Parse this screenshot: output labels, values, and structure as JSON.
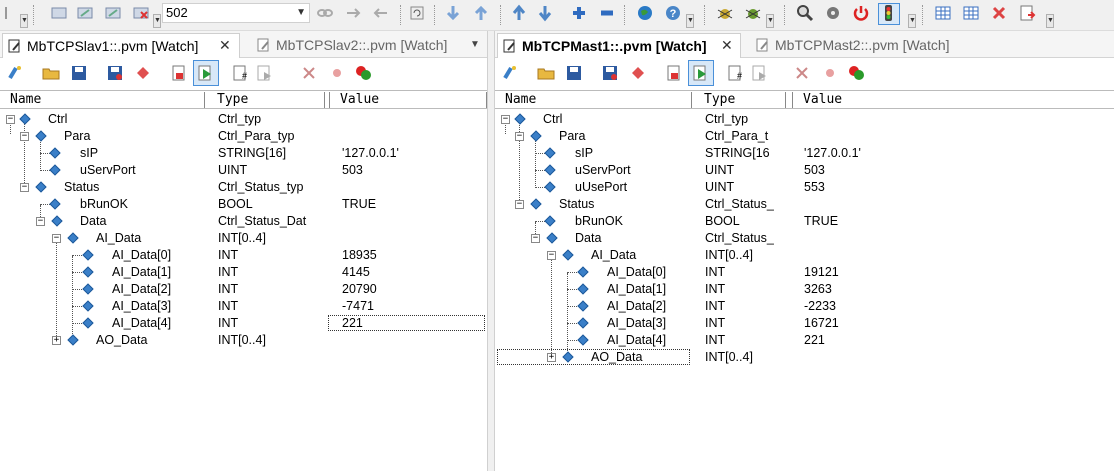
{
  "toolbar": {
    "combo_value": "502",
    "icons": [
      "new-icon",
      "open-icon",
      "save-icon",
      "delete-icon",
      "zoom-icon",
      "arrow-down-icon",
      "arrow-up-icon",
      "add-icon",
      "remove-icon",
      "globe-icon",
      "help-icon",
      "debug-icon",
      "search-icon",
      "power-icon",
      "traffic-light-icon",
      "table-icon",
      "close-icon",
      "export-icon"
    ]
  },
  "colors": {
    "diamond": "#3a7fc8",
    "highlight": "#4a90d9",
    "panel_bg": "#ffffff",
    "toolbar_bg": "#f0f0f0"
  },
  "left": {
    "tabs": [
      {
        "label": "MbTCPSlav1::.pvm [Watch]"
      },
      {
        "label": "MbTCPSlav2::.pvm [Watch]"
      }
    ],
    "close": "✕",
    "menu": "▼",
    "headers": {
      "name": "Name",
      "type": "Type",
      "value": "Value"
    },
    "rows": [
      {
        "name": "Ctrl",
        "type": "Ctrl_typ",
        "value": ""
      },
      {
        "name": "Para",
        "type": "Ctrl_Para_typ",
        "value": ""
      },
      {
        "name": "sIP",
        "type": "STRING[16]",
        "value": "'127.0.0.1'"
      },
      {
        "name": "uServPort",
        "type": "UINT",
        "value": "503"
      },
      {
        "name": "Status",
        "type": "Ctrl_Status_typ",
        "value": ""
      },
      {
        "name": "bRunOK",
        "type": "BOOL",
        "value": "TRUE"
      },
      {
        "name": "Data",
        "type": "Ctrl_Status_Dat",
        "value": ""
      },
      {
        "name": "AI_Data",
        "type": "INT[0..4]",
        "value": ""
      },
      {
        "name": "AI_Data[0]",
        "type": "INT",
        "value": "18935"
      },
      {
        "name": "AI_Data[1]",
        "type": "INT",
        "value": "4145"
      },
      {
        "name": "AI_Data[2]",
        "type": "INT",
        "value": "20790"
      },
      {
        "name": "AI_Data[3]",
        "type": "INT",
        "value": "-7471"
      },
      {
        "name": "AI_Data[4]",
        "type": "INT",
        "value": "221"
      },
      {
        "name": "AO_Data",
        "type": "INT[0..4]",
        "value": ""
      }
    ]
  },
  "right": {
    "tabs": [
      {
        "label": "MbTCPMast1::.pvm [Watch]"
      },
      {
        "label": "MbTCPMast2::.pvm [Watch]"
      }
    ],
    "close": "✕",
    "headers": {
      "name": "Name",
      "type": "Type",
      "value": "Value"
    },
    "rows": [
      {
        "name": "Ctrl",
        "type": "Ctrl_typ",
        "value": ""
      },
      {
        "name": "Para",
        "type": "Ctrl_Para_t",
        "value": ""
      },
      {
        "name": "sIP",
        "type": "STRING[16",
        "value": "'127.0.0.1'"
      },
      {
        "name": "uServPort",
        "type": "UINT",
        "value": "503"
      },
      {
        "name": "uUsePort",
        "type": "UINT",
        "value": "553"
      },
      {
        "name": "Status",
        "type": "Ctrl_Status_",
        "value": ""
      },
      {
        "name": "bRunOK",
        "type": "BOOL",
        "value": "TRUE"
      },
      {
        "name": "Data",
        "type": "Ctrl_Status_",
        "value": ""
      },
      {
        "name": "AI_Data",
        "type": "INT[0..4]",
        "value": ""
      },
      {
        "name": "AI_Data[0]",
        "type": "INT",
        "value": "19121"
      },
      {
        "name": "AI_Data[1]",
        "type": "INT",
        "value": "3263"
      },
      {
        "name": "AI_Data[2]",
        "type": "INT",
        "value": "-2233"
      },
      {
        "name": "AI_Data[3]",
        "type": "INT",
        "value": "16721"
      },
      {
        "name": "AI_Data[4]",
        "type": "INT",
        "value": "221"
      },
      {
        "name": "AO_Data",
        "type": "INT[0..4]",
        "value": ""
      }
    ]
  }
}
